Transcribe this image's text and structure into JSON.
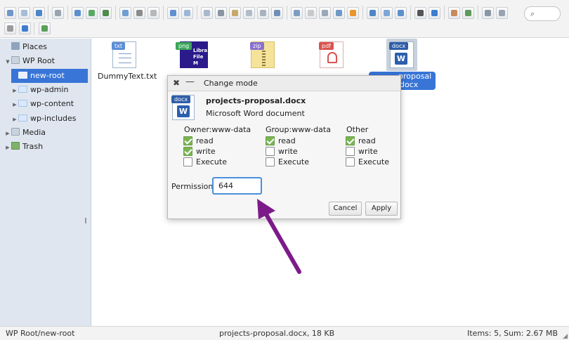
{
  "toolbar": {
    "search_placeholder": ""
  },
  "sidebar": {
    "places": "Places",
    "wp_root": "WP Root",
    "new_root": "new-root",
    "wp_admin": "wp-admin",
    "wp_content": "wp-content",
    "wp_includes": "wp-includes",
    "media": "Media",
    "trash": "Trash"
  },
  "files": {
    "dummy_tag": "txt",
    "dummy_label": "DummyText.txt",
    "png_tag": "png",
    "png_thumb_text": "Libra File M",
    "zip_tag": "zip",
    "pdf_tag": "pdf",
    "docx_tag": "docx",
    "docx_label_1": "proposal",
    "docx_label_2": "docx"
  },
  "dialog": {
    "title": "Change mode",
    "file_tag": "docx",
    "filename": "projects-proposal.docx",
    "filetype": "Microsoft Word document",
    "owner_header": "Owner:www-data",
    "group_header": "Group:www-data",
    "other_header": "Other",
    "read": "read",
    "write": "write",
    "execute": "Execute",
    "permission_label": "Permission:",
    "permission_value": "644",
    "cancel": "Cancel",
    "apply": "Apply",
    "owner": {
      "read": true,
      "write": true,
      "execute": false
    },
    "group": {
      "read": true,
      "write": false,
      "execute": false
    },
    "other": {
      "read": true,
      "write": false,
      "execute": false
    }
  },
  "statusbar": {
    "path": "WP Root/new-root",
    "selected": "projects-proposal.docx, 18 KB",
    "summary": "Items: 5, Sum: 2.67 MB"
  },
  "colors": {
    "selection": "#3875d7",
    "arrow": "#7d1a8a",
    "checkbox_checked": "#7bb552"
  }
}
